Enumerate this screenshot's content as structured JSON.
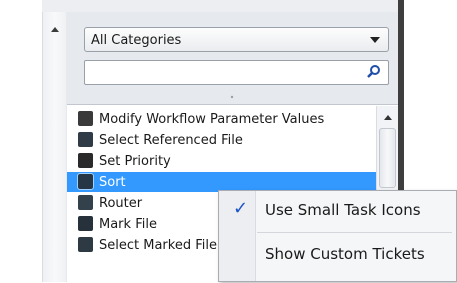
{
  "category_filter": {
    "selected": "All Categories"
  },
  "search": {
    "value": "",
    "placeholder": ""
  },
  "task_list": {
    "items": [
      {
        "label": "Modify Workflow Parameter Values",
        "icon": "modify-workflow-icon",
        "color": "#3a3a3a"
      },
      {
        "label": "Select Referenced File",
        "icon": "select-referenced-file-icon",
        "color": "#2f3b46"
      },
      {
        "label": "Set Priority",
        "icon": "set-priority-icon",
        "color": "#2a2a2a"
      },
      {
        "label": "Sort",
        "icon": "sort-icon",
        "color": "#273645"
      },
      {
        "label": "Router",
        "icon": "router-icon",
        "color": "#33414d"
      },
      {
        "label": "Mark File",
        "icon": "mark-file-icon",
        "color": "#26313b"
      },
      {
        "label": "Select Marked File",
        "icon": "select-marked-file-icon",
        "color": "#2d3a44"
      }
    ],
    "selected_index": 3
  },
  "context_menu": {
    "items": [
      {
        "label": "Use Small Task Icons",
        "checked": true
      },
      {
        "label": "Show Custom Tickets",
        "checked": false
      }
    ]
  },
  "colors": {
    "selection": "#3399ff",
    "panel": "#e6e9ee"
  }
}
